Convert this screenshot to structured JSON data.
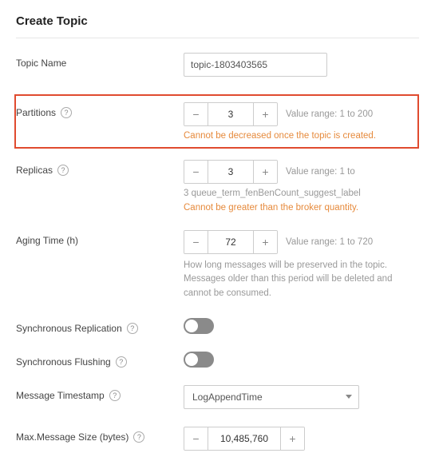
{
  "title": "Create Topic",
  "topicName": {
    "label": "Topic Name",
    "value": "topic-1803403565"
  },
  "partitions": {
    "label": "Partitions",
    "value": "3",
    "range": "Value range: 1 to 200",
    "warning": "Cannot be decreased once the topic is created."
  },
  "replicas": {
    "label": "Replicas",
    "value": "3",
    "range": "Value range: 1 to",
    "sub": "3  queue_term_fenBenCount_suggest_label",
    "warning": "Cannot be greater than the broker quantity."
  },
  "aging": {
    "label": "Aging Time (h)",
    "value": "72",
    "range": "Value range: 1 to 720",
    "desc": "How long messages will be preserved in the topic. Messages older than this period will be deleted and cannot be consumed."
  },
  "syncReplication": {
    "label": "Synchronous Replication"
  },
  "syncFlushing": {
    "label": "Synchronous Flushing"
  },
  "msgTimestamp": {
    "label": "Message Timestamp",
    "value": "LogAppendTime"
  },
  "maxMsgSize": {
    "label": "Max.Message Size (bytes)",
    "value": "10,485,760"
  }
}
